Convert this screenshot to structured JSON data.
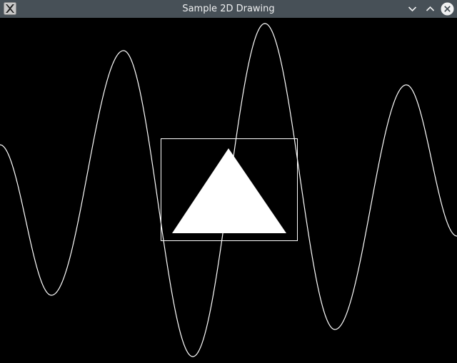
{
  "window": {
    "title": "Sample 2D Drawing",
    "icons": {
      "app": "x11-app-icon",
      "minimize": "chevron-down-icon",
      "maximize": "chevron-up-icon",
      "close": "close-icon"
    },
    "colors": {
      "titlebar_bg": "#475057",
      "title_text": "#eff0f1",
      "canvas_bg": "#000000",
      "drawing": "#ffffff"
    }
  }
}
